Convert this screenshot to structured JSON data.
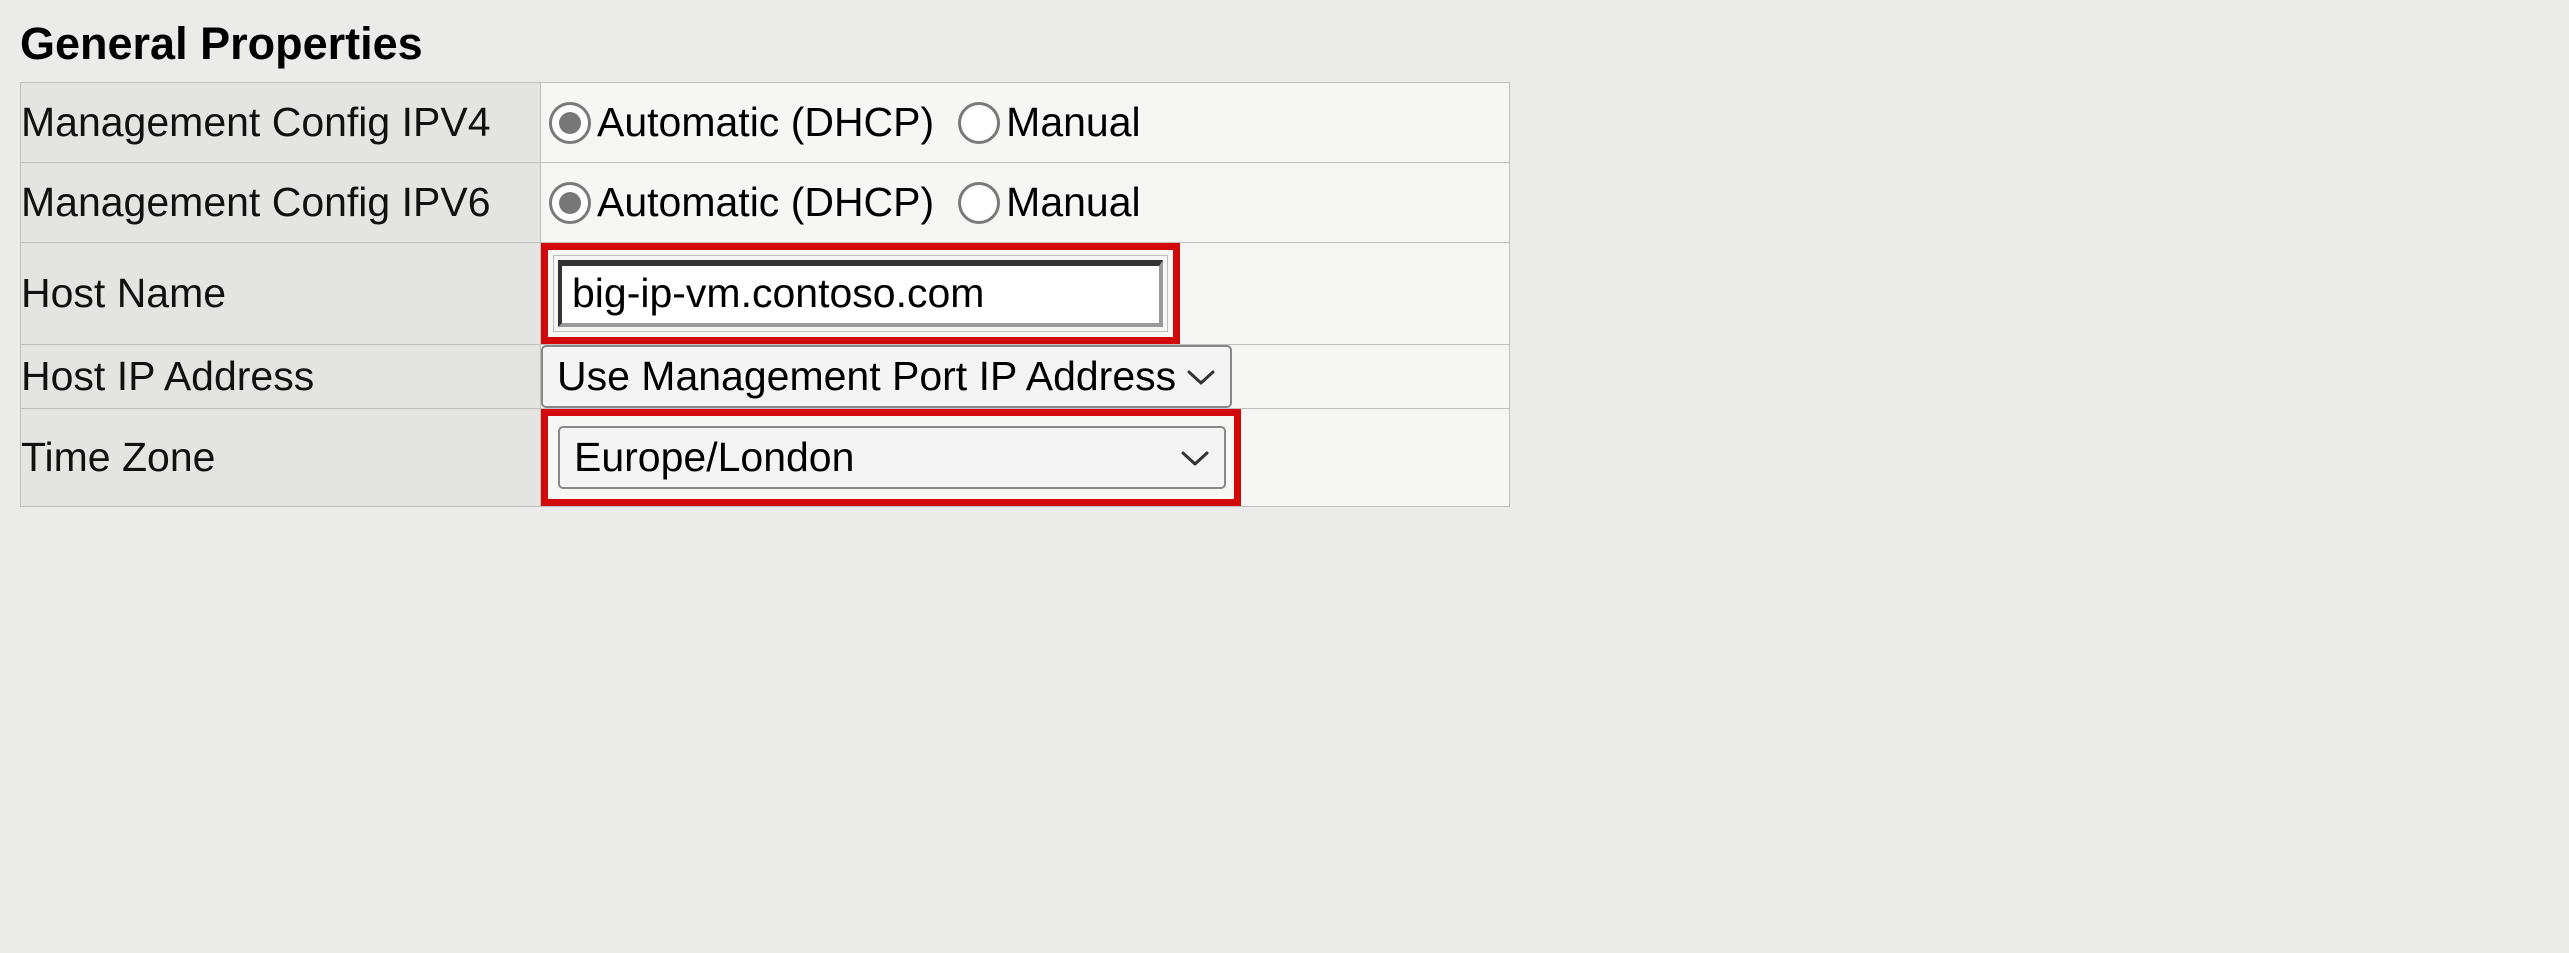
{
  "heading": "General Properties",
  "rows": {
    "ipv4": {
      "label": "Management Config IPV4",
      "opt_auto": "Automatic (DHCP)",
      "opt_manual": "Manual"
    },
    "ipv6": {
      "label": "Management Config IPV6",
      "opt_auto": "Automatic (DHCP)",
      "opt_manual": "Manual"
    },
    "hostname": {
      "label": "Host Name",
      "value": "big-ip-vm.contoso.com"
    },
    "hostip": {
      "label": "Host IP Address",
      "value": "Use Management Port IP Address"
    },
    "timezone": {
      "label": "Time Zone",
      "value": "Europe/London"
    }
  }
}
